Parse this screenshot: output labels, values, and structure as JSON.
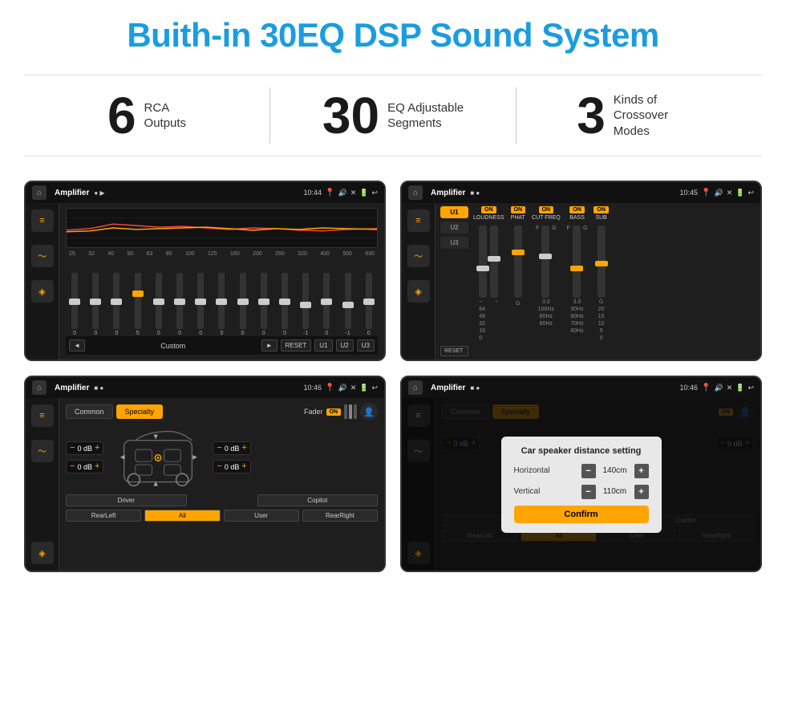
{
  "title": "Buith-in 30EQ DSP Sound System",
  "stats": [
    {
      "number": "6",
      "label": "RCA\nOutputs"
    },
    {
      "number": "30",
      "label": "EQ Adjustable\nSegments"
    },
    {
      "number": "3",
      "label": "Kinds of\nCrossover Modes"
    }
  ],
  "screens": [
    {
      "id": "screen1",
      "time": "10:44",
      "app": "Amplifier",
      "eq_freqs": [
        "25",
        "32",
        "40",
        "50",
        "63",
        "80",
        "100",
        "125",
        "160",
        "200",
        "250",
        "320",
        "400",
        "500",
        "630"
      ],
      "eq_values": [
        "0",
        "0",
        "0",
        "5",
        "0",
        "0",
        "0",
        "0",
        "0",
        "0",
        "0",
        "-1",
        "0",
        "-1"
      ],
      "eq_preset": "Custom",
      "buttons": [
        "◄",
        "Custom",
        "►",
        "RESET",
        "U1",
        "U2",
        "U3"
      ]
    },
    {
      "id": "screen2",
      "time": "10:45",
      "app": "Amplifier",
      "channels": [
        "U1",
        "U2",
        "U3"
      ],
      "controls": [
        "LOUDNESS",
        "PHAT",
        "CUT FREQ",
        "BASS",
        "SUB"
      ],
      "reset": "RESET"
    },
    {
      "id": "screen3",
      "time": "10:46",
      "app": "Amplifier",
      "tabs": [
        "Common",
        "Specialty"
      ],
      "active_tab": "Specialty",
      "fader_label": "Fader",
      "fader_on": "ON",
      "db_values": [
        "0 dB",
        "0 dB",
        "0 dB",
        "0 dB"
      ],
      "bottom_buttons": [
        "Driver",
        "RearLeft",
        "All",
        "User",
        "Copilot",
        "RearRight"
      ]
    },
    {
      "id": "screen4",
      "time": "10:46",
      "app": "Amplifier",
      "tabs": [
        "Common",
        "Specialty"
      ],
      "dialog": {
        "title": "Car speaker distance setting",
        "horizontal_label": "Horizontal",
        "horizontal_value": "140cm",
        "vertical_label": "Vertical",
        "vertical_value": "110cm",
        "confirm_label": "Confirm"
      }
    }
  ]
}
